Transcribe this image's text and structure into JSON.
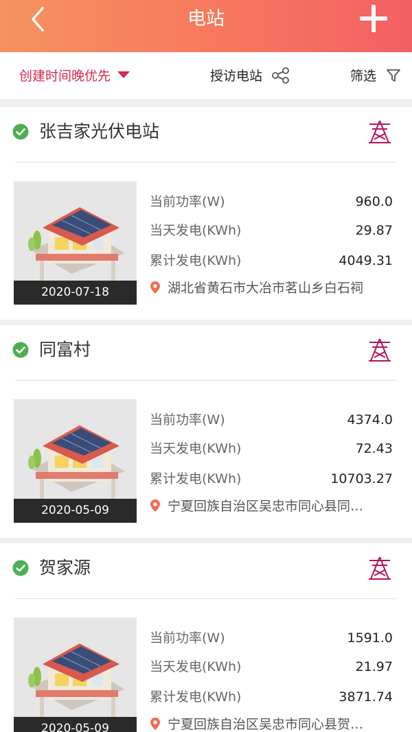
{
  "header": {
    "title": "电站"
  },
  "filterbar": {
    "sort_label": "创建时间晚优先",
    "visit_label": "授访电站",
    "filter_label": "筛选"
  },
  "colors": {
    "accent": "#d8284a",
    "header_start": "#f6925f",
    "header_end": "#f45f63",
    "status_ok": "#4caf50",
    "tower": "#c2185b"
  },
  "stations": [
    {
      "name": "张吉家光伏电站",
      "date": "2020-07-18",
      "power_label": "当前功率(W)",
      "power": "960.0",
      "today_label": "当天发电(KWh)",
      "today": "29.87",
      "total_label": "累计发电(KWh)",
      "total": "4049.31",
      "location": "湖北省黄石市大冶市茗山乡白石祠"
    },
    {
      "name": "同富村",
      "date": "2020-05-09",
      "power_label": "当前功率(W)",
      "power": "4374.0",
      "today_label": "当天发电(KWh)",
      "today": "72.43",
      "total_label": "累计发电(KWh)",
      "total": "10703.27",
      "location": "宁夏回族自治区吴忠市同心县同…"
    },
    {
      "name": "贺家源",
      "date": "2020-05-09",
      "power_label": "当前功率(W)",
      "power": "1591.0",
      "today_label": "当天发电(KWh)",
      "today": "21.97",
      "total_label": "累计发电(KWh)",
      "total": "3871.74",
      "location": "宁夏回族自治区吴忠市同心县贺…"
    }
  ]
}
